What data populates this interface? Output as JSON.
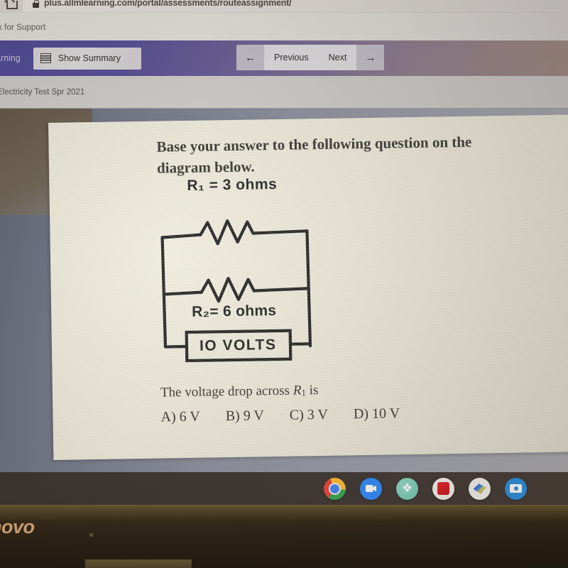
{
  "browser": {
    "home_icon": "home-icon",
    "lock_icon": "lock-icon",
    "url": "plus.allmlearning.com/portal/assessments/routeassignment/",
    "bookmark_label": "k for Support"
  },
  "app_toolbar": {
    "brand_fragment": "arning",
    "summary_icon": "summary-list-icon",
    "summary_label": "Show Summary",
    "nav": {
      "back_icon": "arrow-left-icon",
      "previous_label": "Previous",
      "next_label": "Next",
      "forward_icon": "arrow-right-icon"
    },
    "accent_color": "#4a4494"
  },
  "crumb": {
    "assignment_title": "Electricity Test Spr 2021"
  },
  "worksheet": {
    "stem": "Base your answer to the following question on the diagram below.",
    "diagram": {
      "r1_label": "R₁ = 3 ohms",
      "r2_label": "R₂= 6 ohms",
      "source_label": "IO  VOLTS"
    },
    "question_prefix": "The voltage drop across ",
    "question_var": "R",
    "question_sub": "1",
    "question_suffix": " is",
    "choices": [
      {
        "letter": "A)",
        "value": "6 V"
      },
      {
        "letter": "B)",
        "value": "9 V"
      },
      {
        "letter": "C)",
        "value": "3 V"
      },
      {
        "letter": "D)",
        "value": "10 V"
      }
    ]
  },
  "shelf": {
    "icons": [
      {
        "name": "chrome-icon",
        "glyph": ""
      },
      {
        "name": "zoom-icon",
        "glyph": ""
      },
      {
        "name": "cube-app-icon",
        "glyph": "❖"
      },
      {
        "name": "red-app-icon",
        "glyph": ""
      },
      {
        "name": "blue-app-icon",
        "glyph": ""
      },
      {
        "name": "camera-icon",
        "glyph": ""
      }
    ]
  },
  "device": {
    "brand_fragment": "novo"
  }
}
